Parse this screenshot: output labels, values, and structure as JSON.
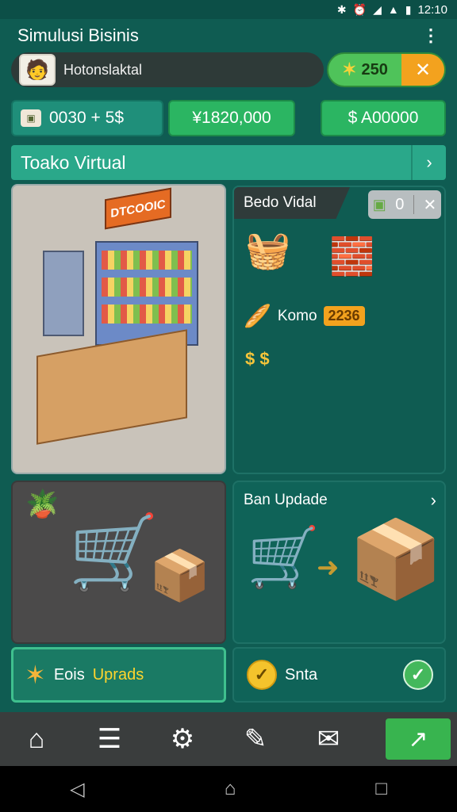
{
  "status_bar": {
    "time": "12:10",
    "icons": [
      "bluetooth-icon",
      "alarm-icon",
      "wifi-icon",
      "signal-icon",
      "battery-icon"
    ]
  },
  "app": {
    "title": "Simulusi Bisinis",
    "menu_icon": "more-vert-icon"
  },
  "profile": {
    "avatar_icon": "avatar-icon",
    "name": "Hotonslaktal",
    "currency_value": "250",
    "close_icon": "close-icon"
  },
  "stats": [
    {
      "icon": "wallet-icon",
      "label": "0030 + 5$"
    },
    {
      "label": "¥1820,000"
    },
    {
      "label": "$ A00000"
    }
  ],
  "store": {
    "label": "Toako Virtual",
    "arrow_icon": "chevron-right-icon"
  },
  "info_panel": {
    "title": "Bedo Vidal",
    "item_label": "Komo",
    "item_badge": "2236",
    "money": "$ $",
    "controls_text": "0"
  },
  "upgrade_panel": {
    "title": "Ban Updade",
    "arrow_icon": "chevron-right-icon"
  },
  "actions": {
    "bonus_prefix": "Eois ",
    "bonus_accent": "Uprads",
    "status_label": "Snta"
  },
  "scene": {
    "sign_text": "DTCOOIC"
  },
  "navigation": {
    "items": [
      "home-icon",
      "clipboard-icon",
      "settings-icon",
      "edit-icon",
      "mail-icon",
      "trend-icon"
    ]
  },
  "system_nav": [
    "back-icon",
    "home-icon",
    "recent-apps-icon"
  ],
  "colors": {
    "background": "#0f5c52",
    "accent_green": "#2bb562",
    "accent_orange": "#f3a21e",
    "nav_active": "#38b44f"
  }
}
